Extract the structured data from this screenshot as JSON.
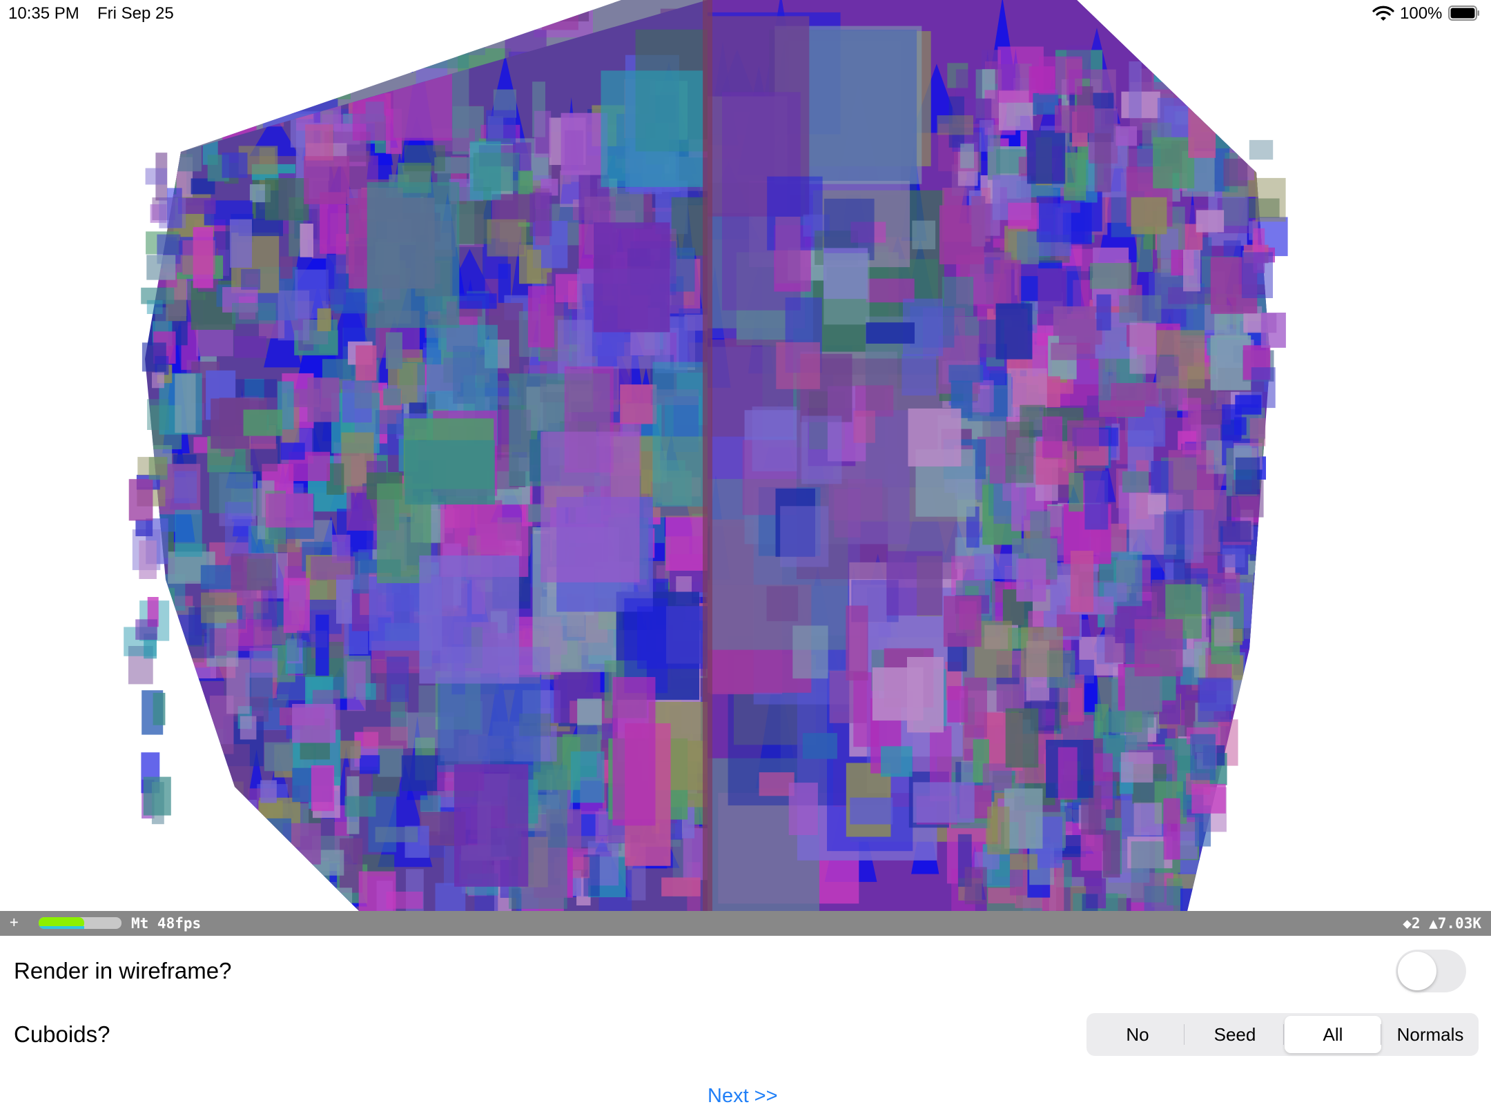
{
  "status_bar": {
    "time": "10:35 PM",
    "date": "Fri Sep 25",
    "battery_percent": "100%",
    "battery_level": 1.0,
    "wifi_icon": "wifi-icon",
    "battery_icon": "battery-icon"
  },
  "stats": {
    "plus": "+",
    "fps": "Mt 48fps",
    "geometry": "◆2 ▲7.03K",
    "meter_level": 0.55
  },
  "wireframe": {
    "label": "Render in wireframe?",
    "enabled": false
  },
  "cuboids": {
    "label": "Cuboids?",
    "options": [
      "No",
      "Seed",
      "All",
      "Normals"
    ],
    "selected": "All"
  },
  "next": {
    "label": "Next >>"
  },
  "colors": {
    "link": "#1f7ff7",
    "meter_green": "#8cf000",
    "meter_cyan": "#2fc8e0"
  }
}
